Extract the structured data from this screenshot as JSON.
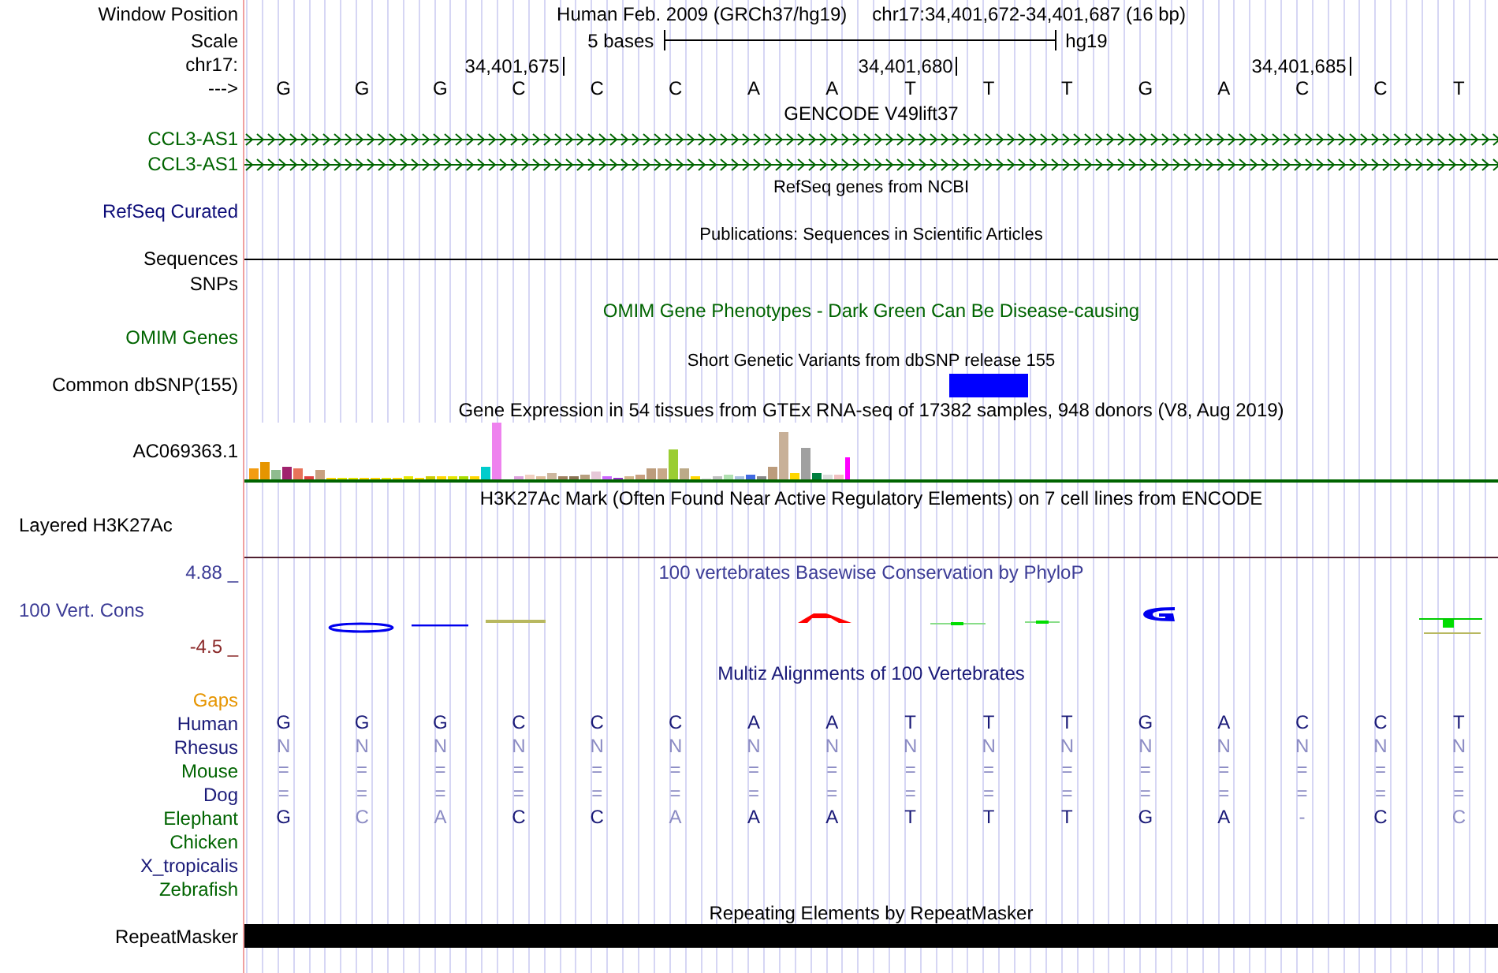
{
  "header": {
    "position_label": "Window Position",
    "assembly": "Human Feb. 2009 (GRCh37/hg19)",
    "position": "chr17:34,401,672-34,401,687 (16 bp)",
    "scale_label": "Scale",
    "scale_text": "5 bases",
    "scale_db": "hg19",
    "chrom_label": "chr17:",
    "strand_label": "--->"
  },
  "bases": [
    {
      "base": "G"
    },
    {
      "base": "G"
    },
    {
      "base": "G"
    },
    {
      "base": "C",
      "tick": "34,401,675"
    },
    {
      "base": "C"
    },
    {
      "base": "C"
    },
    {
      "base": "A"
    },
    {
      "base": "A"
    },
    {
      "base": "T",
      "tick": "34,401,680"
    },
    {
      "base": "T"
    },
    {
      "base": "T"
    },
    {
      "base": "G"
    },
    {
      "base": "A"
    },
    {
      "base": "C",
      "tick": "34,401,685"
    },
    {
      "base": "C"
    },
    {
      "base": "T"
    }
  ],
  "tracks": [
    {
      "kind": "gene",
      "title": "GENCODE V49lift37",
      "genes": [
        {
          "name": "CCL3-AS1",
          "color": "#006400"
        },
        {
          "name": "CCL3-AS1",
          "color": "#006400"
        }
      ]
    },
    {
      "kind": "empty",
      "title": "RefSeq genes from NCBI",
      "label": "RefSeq Curated",
      "color": "#0c0c78"
    },
    {
      "kind": "line",
      "title": "Publications: Sequences in Scientific Articles",
      "label": "Sequences",
      "color": "#000000"
    },
    {
      "kind": "label_only",
      "label": "SNPs",
      "color": "#000000"
    },
    {
      "kind": "phenotype",
      "title": "OMIM Gene Phenotypes - Dark Green Can Be Disease-causing",
      "label": "OMIM Genes",
      "color": "#006400"
    },
    {
      "kind": "snp",
      "title": "Short Genetic Variants from dbSNP release 155",
      "label": "Common dbSNP(155)",
      "color": "#000000"
    },
    {
      "kind": "expression",
      "title": "Gene Expression in 54 tissues from GTEx RNA-seq of 17382 samples, 948 donors (V8, Aug 2019)",
      "label": "AC069363.1",
      "color": "#000000"
    },
    {
      "kind": "signal",
      "title": "H3K27Ac Mark (Often Found Near Active Regulatory Elements) on 7 cell lines from ENCODE",
      "label": "Layered H3K27Ac",
      "color": "#000000"
    },
    {
      "kind": "conservation",
      "title": "100 vertebrates Basewise Conservation by PhyloP",
      "label": "100 Vert. Cons",
      "color": "#3c3c96",
      "max_label": "4.88 _",
      "min_label": "-4.5 _"
    },
    {
      "kind": "alignment",
      "title": "Multiz Alignments of 100 Vertebrates",
      "species": [
        {
          "name": "Gaps",
          "color": "#e69500"
        },
        {
          "name": "Human",
          "color": "#1a1a78",
          "bases": [
            {
              "base": "G",
              "mismatch": false
            },
            {
              "base": "G",
              "mismatch": false
            },
            {
              "base": "G",
              "mismatch": false
            },
            {
              "base": "C",
              "mismatch": false
            },
            {
              "base": "C",
              "mismatch": false
            },
            {
              "base": "C",
              "mismatch": false
            },
            {
              "base": "A",
              "mismatch": false
            },
            {
              "base": "A",
              "mismatch": false
            },
            {
              "base": "T",
              "mismatch": false
            },
            {
              "base": "T",
              "mismatch": false
            },
            {
              "base": "T",
              "mismatch": false
            },
            {
              "base": "G",
              "mismatch": false
            },
            {
              "base": "A",
              "mismatch": false
            },
            {
              "base": "C",
              "mismatch": false
            },
            {
              "base": "C",
              "mismatch": false
            },
            {
              "base": "T",
              "mismatch": false
            }
          ]
        },
        {
          "name": "Rhesus",
          "color": "#1a1a78",
          "bases": [
            {
              "base": "N",
              "mismatch": true
            },
            {
              "base": "N",
              "mismatch": true
            },
            {
              "base": "N",
              "mismatch": true
            },
            {
              "base": "N",
              "mismatch": true
            },
            {
              "base": "N",
              "mismatch": true
            },
            {
              "base": "N",
              "mismatch": true
            },
            {
              "base": "N",
              "mismatch": true
            },
            {
              "base": "N",
              "mismatch": true
            },
            {
              "base": "N",
              "mismatch": true
            },
            {
              "base": "N",
              "mismatch": true
            },
            {
              "base": "N",
              "mismatch": true
            },
            {
              "base": "N",
              "mismatch": true
            },
            {
              "base": "N",
              "mismatch": true
            },
            {
              "base": "N",
              "mismatch": true
            },
            {
              "base": "N",
              "mismatch": true
            },
            {
              "base": "N",
              "mismatch": true
            }
          ]
        },
        {
          "name": "Mouse",
          "color": "#006400",
          "bases": [
            {
              "base": "=",
              "mismatch": true
            },
            {
              "base": "=",
              "mismatch": true
            },
            {
              "base": "=",
              "mismatch": true
            },
            {
              "base": "=",
              "mismatch": true
            },
            {
              "base": "=",
              "mismatch": true
            },
            {
              "base": "=",
              "mismatch": true
            },
            {
              "base": "=",
              "mismatch": true
            },
            {
              "base": "=",
              "mismatch": true
            },
            {
              "base": "=",
              "mismatch": true
            },
            {
              "base": "=",
              "mismatch": true
            },
            {
              "base": "=",
              "mismatch": true
            },
            {
              "base": "=",
              "mismatch": true
            },
            {
              "base": "=",
              "mismatch": true
            },
            {
              "base": "=",
              "mismatch": true
            },
            {
              "base": "=",
              "mismatch": true
            },
            {
              "base": "=",
              "mismatch": true
            }
          ]
        },
        {
          "name": "Dog",
          "color": "#1a1a78",
          "bases": [
            {
              "base": "=",
              "mismatch": true
            },
            {
              "base": "=",
              "mismatch": true
            },
            {
              "base": "=",
              "mismatch": true
            },
            {
              "base": "=",
              "mismatch": true
            },
            {
              "base": "=",
              "mismatch": true
            },
            {
              "base": "=",
              "mismatch": true
            },
            {
              "base": "=",
              "mismatch": true
            },
            {
              "base": "=",
              "mismatch": true
            },
            {
              "base": "=",
              "mismatch": true
            },
            {
              "base": "=",
              "mismatch": true
            },
            {
              "base": "=",
              "mismatch": true
            },
            {
              "base": "=",
              "mismatch": true
            },
            {
              "base": "=",
              "mismatch": true
            },
            {
              "base": "=",
              "mismatch": true
            },
            {
              "base": "=",
              "mismatch": true
            },
            {
              "base": "=",
              "mismatch": true
            }
          ]
        },
        {
          "name": "Elephant",
          "color": "#006400",
          "bases": [
            {
              "base": "G",
              "mismatch": false
            },
            {
              "base": "C",
              "mismatch": true
            },
            {
              "base": "A",
              "mismatch": true
            },
            {
              "base": "C",
              "mismatch": false
            },
            {
              "base": "C",
              "mismatch": false
            },
            {
              "base": "A",
              "mismatch": true
            },
            {
              "base": "A",
              "mismatch": false
            },
            {
              "base": "A",
              "mismatch": false
            },
            {
              "base": "T",
              "mismatch": false
            },
            {
              "base": "T",
              "mismatch": false
            },
            {
              "base": "T",
              "mismatch": false
            },
            {
              "base": "G",
              "mismatch": false
            },
            {
              "base": "A",
              "mismatch": false
            },
            {
              "base": "-",
              "mismatch": true
            },
            {
              "base": "C",
              "mismatch": false
            },
            {
              "base": "C",
              "mismatch": true
            }
          ]
        },
        {
          "name": "Chicken",
          "color": "#006400"
        },
        {
          "name": "X_tropicalis",
          "color": "#1a1a78"
        },
        {
          "name": "Zebrafish",
          "color": "#006400"
        }
      ]
    },
    {
      "kind": "repeat",
      "title": "Repeating Elements by RepeatMasker",
      "label": "RepeatMasker",
      "color": "#000000"
    }
  ]
}
